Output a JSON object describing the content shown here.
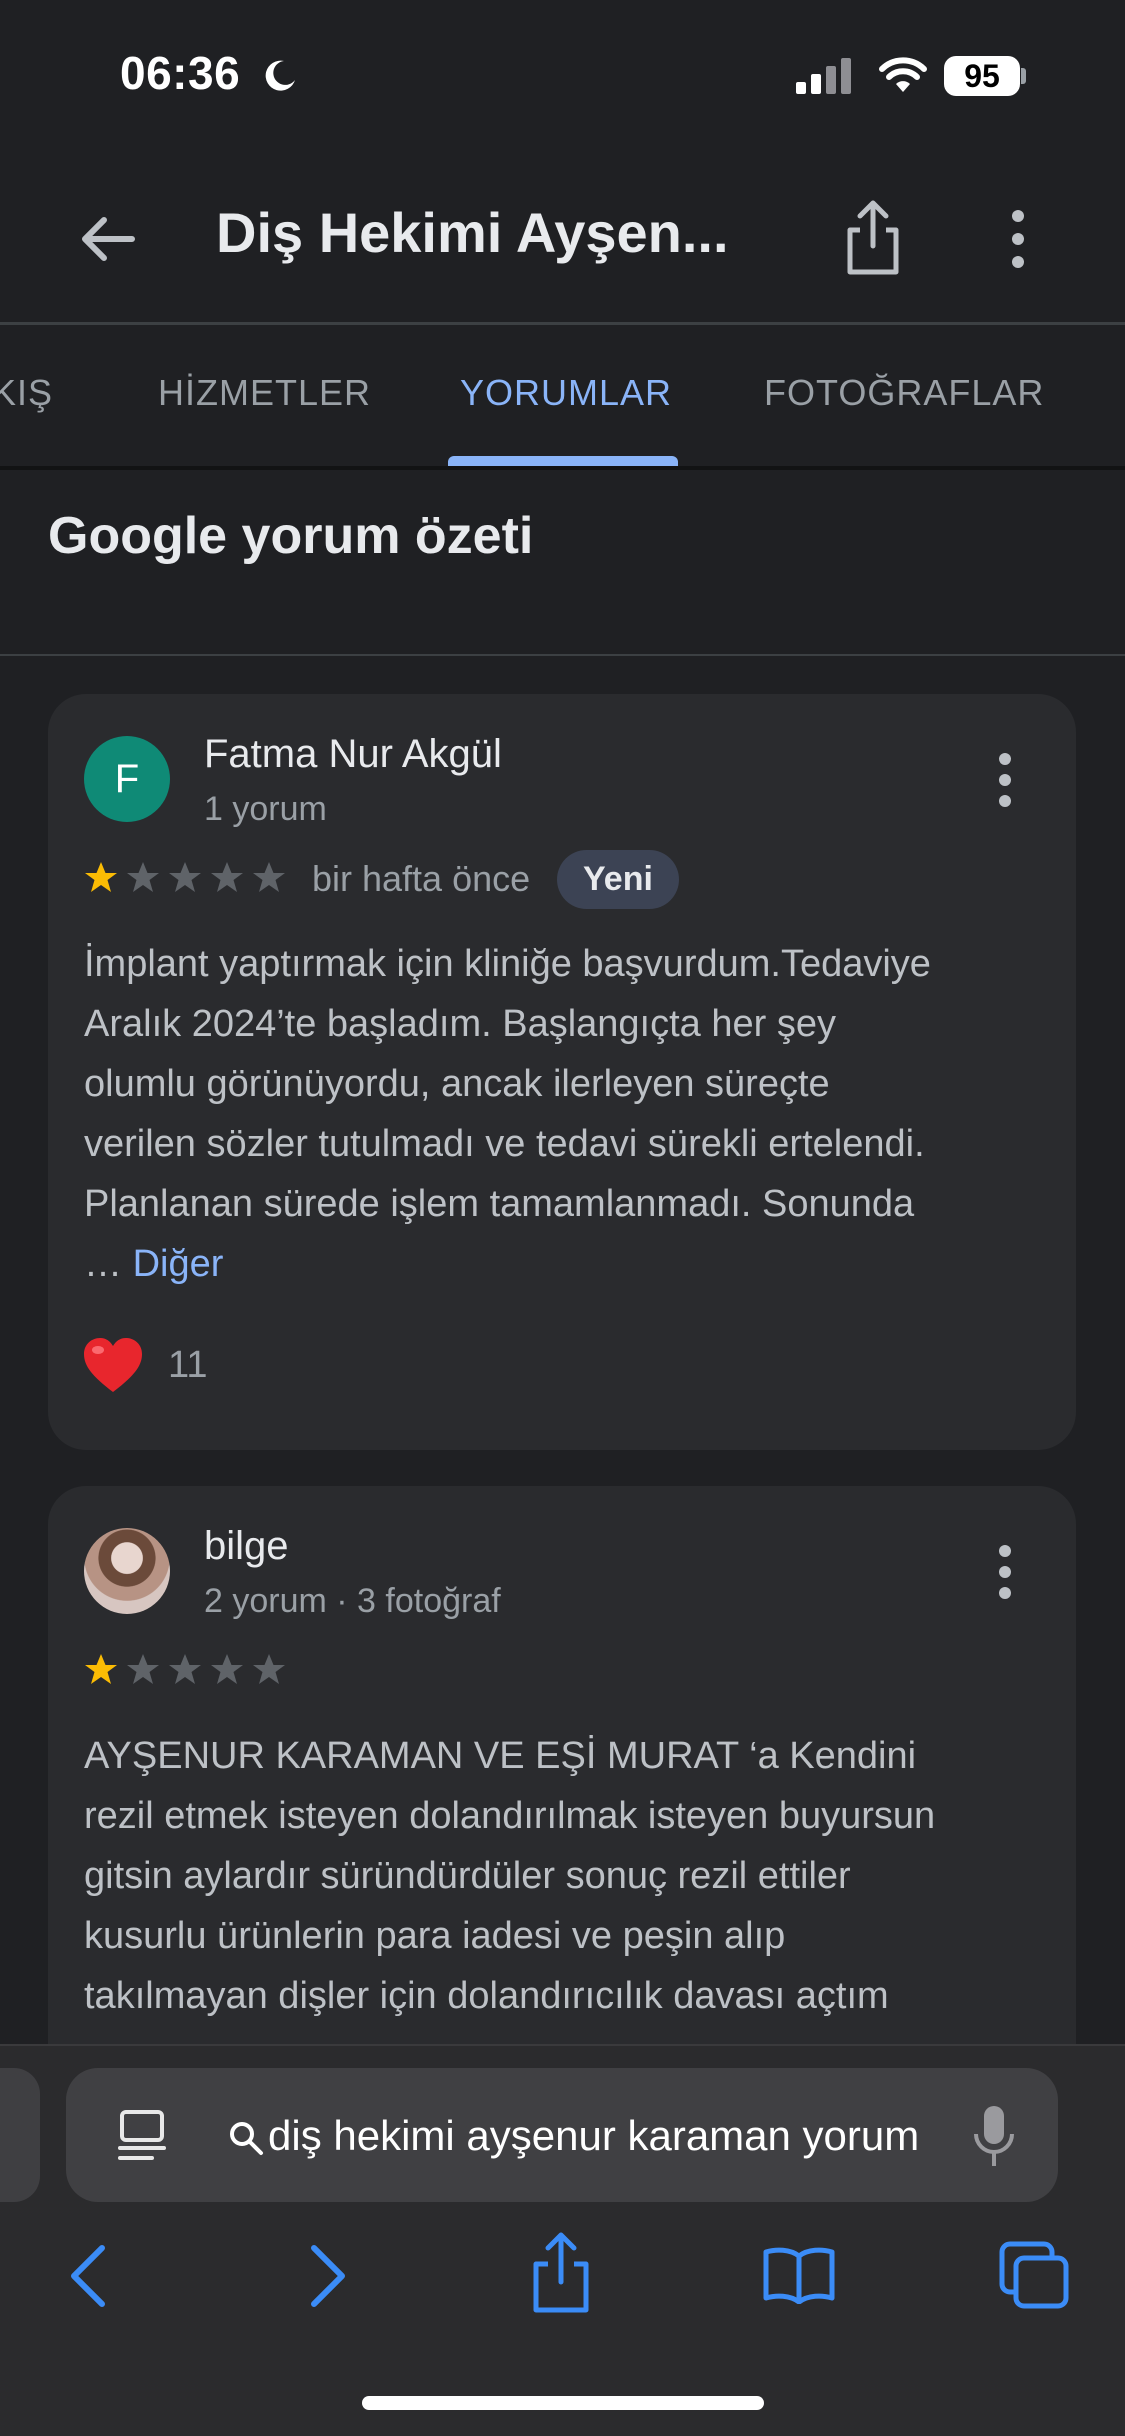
{
  "status_bar": {
    "time": "06:36",
    "battery": "95"
  },
  "app_bar": {
    "title": "Diş Hekimi Ayşen..."
  },
  "tabs": [
    {
      "label": "KIŞ",
      "active": false
    },
    {
      "label": "HİZMETLER",
      "active": false
    },
    {
      "label": "YORUMLAR",
      "active": true
    },
    {
      "label": "FOTOĞRAFLAR",
      "active": false
    }
  ],
  "section_title": "Google yorum özeti",
  "reviews": [
    {
      "avatar_letter": "F",
      "name": "Fatma Nur Akgül",
      "meta": "1 yorum",
      "rating": 1,
      "when": "bir hafta önce",
      "badge": "Yeni",
      "lines": [
        "İmplant yaptırmak için kliniğe başvurdum.Tedaviye",
        "Aralık 2024’te başladım. Başlangıçta her şey",
        "olumlu görünüyordu, ancak ilerleyen süreçte",
        "verilen sözler tutulmadı ve tedavi sürekli ertelendi.",
        "Planlanan sürede işlem tamamlanmadı. Sonunda"
      ],
      "ellipsis": "…",
      "more_label": "Diğer",
      "likes": "11"
    },
    {
      "name": "bilge",
      "meta": "2 yorum · 3 fotoğraf",
      "rating": 1,
      "lines": [
        "AYŞENUR KARAMAN VE EŞİ MURAT ‘a Kendini",
        "rezil etmek isteyen dolandırılmak isteyen buyursun",
        "gitsin aylardır süründürdüler sonuç rezil ettiler",
        "kusurlu ürünlerin para iadesi ve peşin alıp",
        "takılmayan dişler için dolandırıcılık davası açtım"
      ]
    }
  ],
  "browser": {
    "url_text": "diş hekimi ayşenur karaman yorum"
  },
  "colors": {
    "accent": "#8ab4f8",
    "star_filled": "#fbbc04",
    "star_empty": "#5f6368",
    "avatar_f": "#0f8a76"
  }
}
